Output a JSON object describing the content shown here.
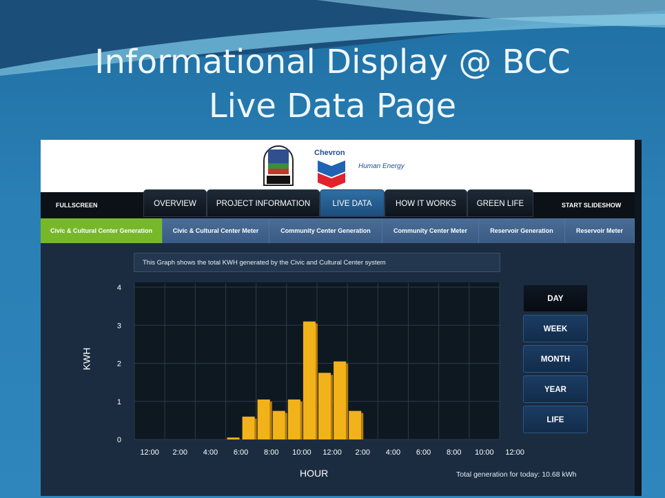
{
  "slide": {
    "title_line1": "Informational Display @ BCC",
    "title_line2": "Live Data Page"
  },
  "header": {
    "chevron_word": "Chevron",
    "tagline": "Human Energy"
  },
  "nav": {
    "fullscreen": "FULLSCREEN",
    "start_slideshow": "START SLIDESHOW",
    "tabs": [
      "OVERVIEW",
      "PROJECT INFORMATION",
      "LIVE DATA",
      "HOW IT WORKS",
      "GREEN LIFE"
    ],
    "active_tab": "LIVE DATA"
  },
  "subtabs": {
    "items": [
      "Civic & Cultural Center Generation",
      "Civic & Cultural Center Meter",
      "Community Center Generation",
      "Community Center Meter",
      "Reservoir Generation",
      "Reservoir Meter"
    ],
    "active": "Civic & Cultural Center Generation",
    "active_color": "#77b82a"
  },
  "description": "This Graph shows the total KWH generated by the Civic and Cultural Center system",
  "range_buttons": {
    "items": [
      "DAY",
      "WEEK",
      "MONTH",
      "YEAR",
      "LIFE"
    ],
    "active": "DAY"
  },
  "total_generation": "Total generation for today: 10.68 kWh",
  "chart_data": {
    "type": "bar",
    "title": "",
    "xlabel": "HOUR",
    "ylabel": "KWH",
    "ylim": [
      0,
      4
    ],
    "yticks": [
      "0",
      "1",
      "2",
      "3",
      "4"
    ],
    "xticks": [
      "12:00",
      "2:00",
      "4:00",
      "6:00",
      "8:00",
      "10:00",
      "12:00",
      "2:00",
      "4:00",
      "6:00",
      "8:00",
      "10:00",
      "12:00"
    ],
    "bar_color": "#f2b21a",
    "grid": true,
    "series": [
      {
        "values": [
          0,
          0,
          0,
          0,
          0,
          0,
          0.05,
          0.6,
          1.05,
          0.75,
          1.05,
          3.1,
          1.75,
          2.05,
          0.75,
          0,
          0,
          0,
          0,
          0,
          0,
          0,
          0,
          0
        ]
      }
    ]
  }
}
